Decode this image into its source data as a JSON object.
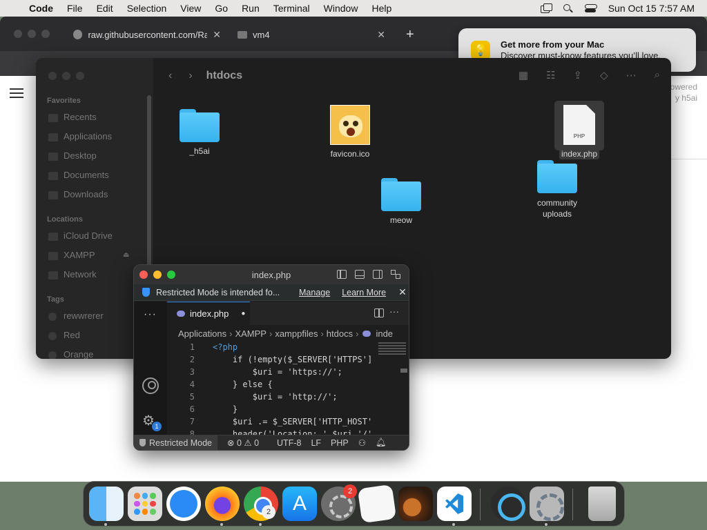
{
  "menubar": {
    "app_name": "Code",
    "items": [
      "File",
      "Edit",
      "Selection",
      "View",
      "Go",
      "Run",
      "Terminal",
      "Window",
      "Help"
    ],
    "datetime": "Sun Oct 15  7:57 AM"
  },
  "browser": {
    "tabs": [
      {
        "title": "raw.githubusercontent.com/Ra",
        "close": "✕"
      },
      {
        "title": "vm4",
        "close": "✕"
      }
    ],
    "new_tab": "+",
    "page_fragment": "owered\ny h5ai"
  },
  "notification": {
    "title": "Get more from your Mac",
    "body": "Discover must-know features you’ll love."
  },
  "finder": {
    "title": "htdocs",
    "sidebar": {
      "favorites_label": "Favorites",
      "favorites": [
        "Recents",
        "Applications",
        "Desktop",
        "Documents",
        "Downloads"
      ],
      "locations_label": "Locations",
      "locations": [
        "iCloud Drive",
        "XAMPP",
        "Network"
      ],
      "tags_label": "Tags",
      "tags": [
        "rewwrerer",
        "Red",
        "Orange"
      ]
    },
    "items": [
      {
        "name": "_h5ai",
        "kind": "folder"
      },
      {
        "name": "favicon.ico",
        "kind": "image"
      },
      {
        "name": "index.php",
        "kind": "php",
        "selected": true
      },
      {
        "name": "meow",
        "kind": "folder"
      },
      {
        "name": "community uploads",
        "kind": "folder"
      }
    ]
  },
  "vscode": {
    "title": "index.php",
    "banner": {
      "message": "Restricted Mode is intended fo...",
      "manage": "Manage",
      "learn_more": "Learn More",
      "close": "✕"
    },
    "tab": {
      "label": "index.php",
      "dirty": "●"
    },
    "breadcrumb": [
      "Applications",
      "XAMPP",
      "xamppfiles",
      "htdocs",
      "inde"
    ],
    "account_badge": "1",
    "code_lines": [
      {
        "n": "1",
        "text": "<?php"
      },
      {
        "n": "2",
        "text": "    if (!empty($_SERVER['HTTPS']"
      },
      {
        "n": "3",
        "text": "        $uri = 'https://';"
      },
      {
        "n": "4",
        "text": "    } else {"
      },
      {
        "n": "5",
        "text": "        $uri = 'http://';"
      },
      {
        "n": "6",
        "text": "    }"
      },
      {
        "n": "7",
        "text": "    $uri .= $_SERVER['HTTP_HOST'"
      },
      {
        "n": "8",
        "text": "    header('Location: '.$uri.'/'"
      }
    ],
    "status": {
      "mode": "Restricted Mode",
      "problems": "⊗ 0 ⚠ 0",
      "encoding": "UTF-8",
      "eol": "LF",
      "language": "PHP"
    }
  },
  "dock": {
    "apps": [
      "finder",
      "launchpad",
      "safari",
      "firefox",
      "chrome",
      "app-store",
      "system-settings",
      "textedit",
      "garageband",
      "vscode",
      "quicktime",
      "system-preferences",
      "trash"
    ],
    "chrome_badge": "2",
    "settings_badge": "2"
  }
}
